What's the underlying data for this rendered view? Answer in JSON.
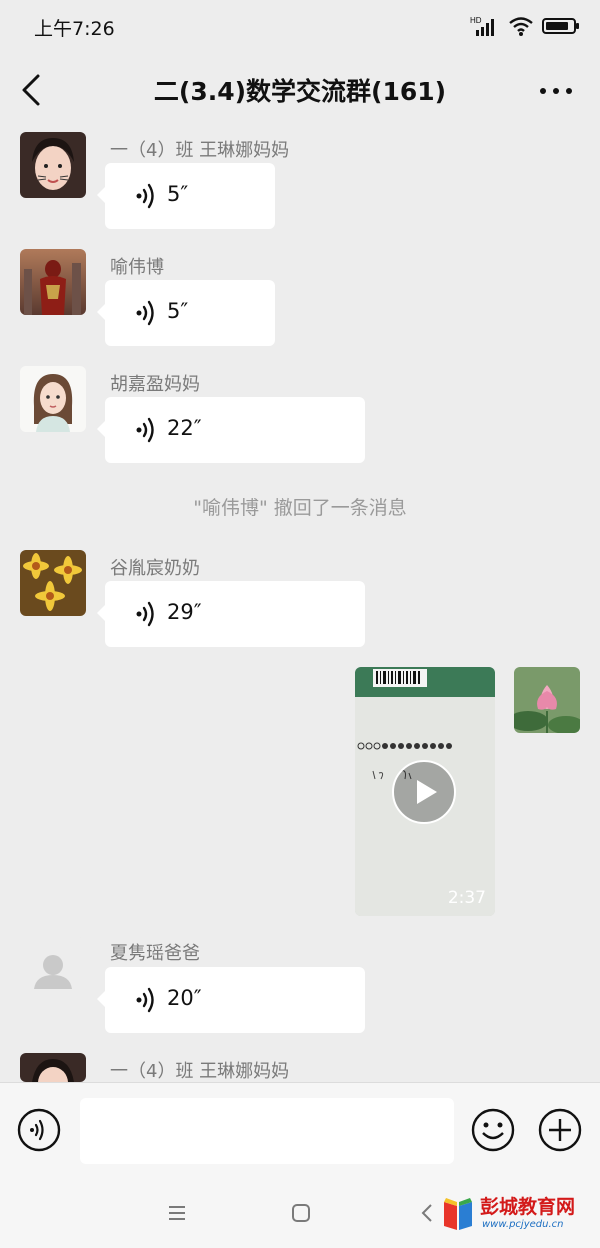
{
  "status": {
    "time": "上午7:26",
    "network": "HD"
  },
  "header": {
    "title": "二(3.4)数学交流群(161)"
  },
  "messages": [
    {
      "sender": "一（4）班 王琳娜妈妈",
      "duration": "5″"
    },
    {
      "sender": "喻伟博",
      "duration": "5″"
    },
    {
      "sender": "胡嘉盈妈妈",
      "duration": "22″"
    },
    {
      "sender": "谷胤宸奶奶",
      "duration": "29″"
    },
    {
      "sender": "夏隽瑶爸爸",
      "duration": "20″"
    },
    {
      "sender": "一（4）班 王琳娜妈妈"
    }
  ],
  "system_notice": "\"喻伟博\" 撤回了一条消息",
  "video": {
    "duration": "2:37"
  },
  "watermark": {
    "name": "彭城教育网",
    "url": "www.pcjyedu.cn"
  },
  "colors": {
    "background": "#ededed",
    "bubble": "#ffffff",
    "sender_text": "#7a7a7a",
    "brand_red": "#d31a1a"
  },
  "icons": [
    "back-icon",
    "more-icon",
    "voice-icon",
    "play-icon",
    "emoji-icon",
    "plus-icon",
    "menu-icon",
    "home-icon",
    "recents-icon"
  ]
}
